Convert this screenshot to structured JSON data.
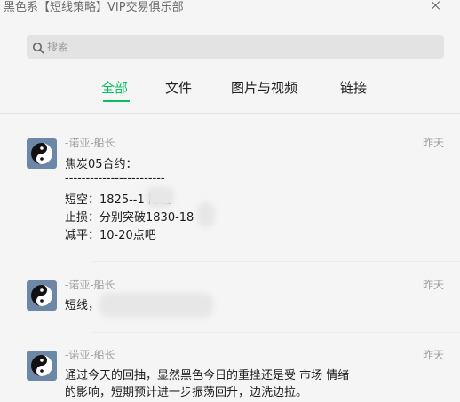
{
  "window": {
    "title": "黑色系【短线策略】VIP交易俱乐部"
  },
  "search": {
    "placeholder": "搜索"
  },
  "tabs": [
    {
      "label": "全部",
      "active": true
    },
    {
      "label": "文件",
      "active": false
    },
    {
      "label": "图片与视频",
      "active": false
    },
    {
      "label": "链接",
      "active": false
    }
  ],
  "messages": [
    {
      "sender": "-诺亚-船长",
      "time": "昨天",
      "lines": [
        "焦炭05合约：",
        "------------------------",
        "短空：1825--1    附近",
        "止损：分别突破1830-18",
        "减平：10-20点吧"
      ]
    },
    {
      "sender": "-诺亚-船长",
      "time": "昨天",
      "lines": [
        "短线，"
      ]
    },
    {
      "sender": "-诺亚-船长",
      "time": "昨天",
      "lines": [
        "通过今天的回抽，显然黑色今日的重挫还是受 市场 情绪",
        "的影响，短期预计进一步振荡回升，边洗边拉。"
      ]
    }
  ],
  "colors": {
    "accent": "#07c160",
    "background": "#f5f5f5",
    "avatar_bg": "#6d88a6"
  }
}
